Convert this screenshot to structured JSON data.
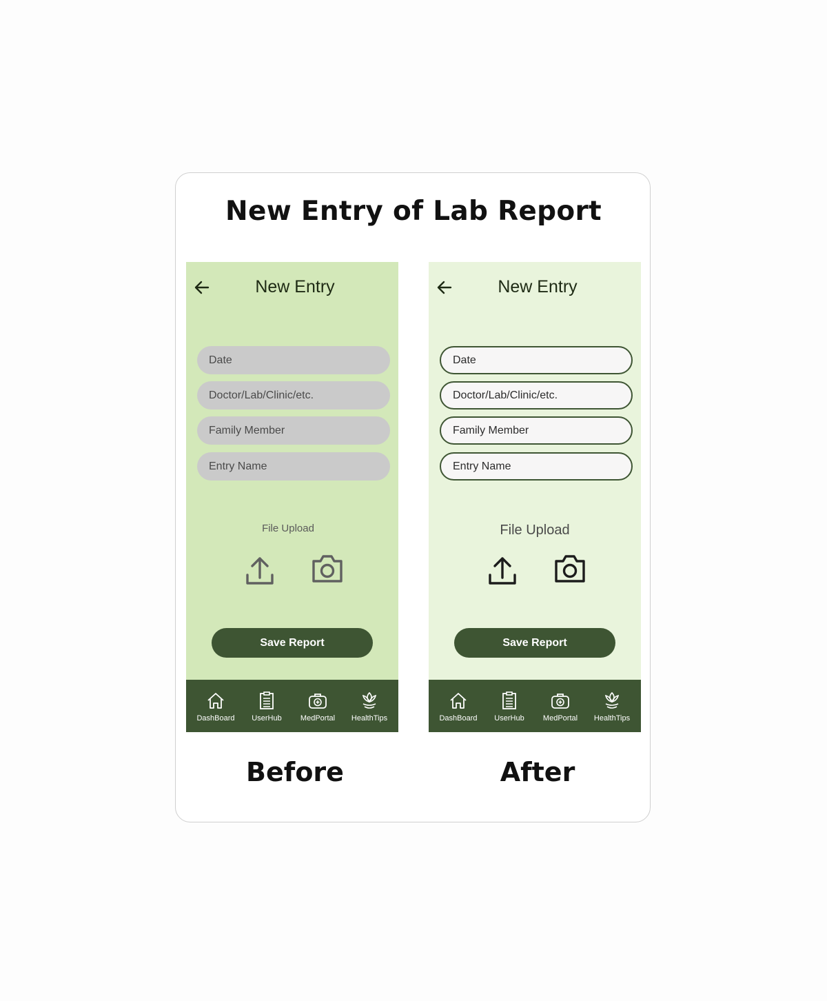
{
  "title": "New Entry of Lab Report",
  "screens": {
    "before": {
      "header_title": "New Entry",
      "fields": [
        "Date",
        "Doctor/Lab/Clinic/etc.",
        "Family Member",
        "Entry Name"
      ],
      "upload_label": "File Upload",
      "save_label": "Save Report",
      "nav": [
        "DashBoard",
        "UserHub",
        "MedPortal",
        "HealthTips"
      ],
      "caption": "Before"
    },
    "after": {
      "header_title": "New Entry",
      "fields": [
        "Date",
        "Doctor/Lab/Clinic/etc.",
        "Family Member",
        "Entry Name"
      ],
      "upload_label": "File Upload",
      "save_label": "Save Report",
      "nav": [
        "DashBoard",
        "UserHub",
        "MedPortal",
        "HealthTips"
      ],
      "caption": "After"
    }
  },
  "icons": {
    "back": "arrow-left-icon",
    "upload": "upload-icon",
    "camera": "camera-icon",
    "nav": [
      "home-icon",
      "clipboard-icon",
      "medkit-icon",
      "lotus-icon"
    ]
  },
  "colors": {
    "before_bg": "#d3e8b9",
    "after_bg": "#e9f4dc",
    "primary": "#3e5533",
    "before_field": "#cacaca",
    "after_field": "#f7f6f6"
  }
}
